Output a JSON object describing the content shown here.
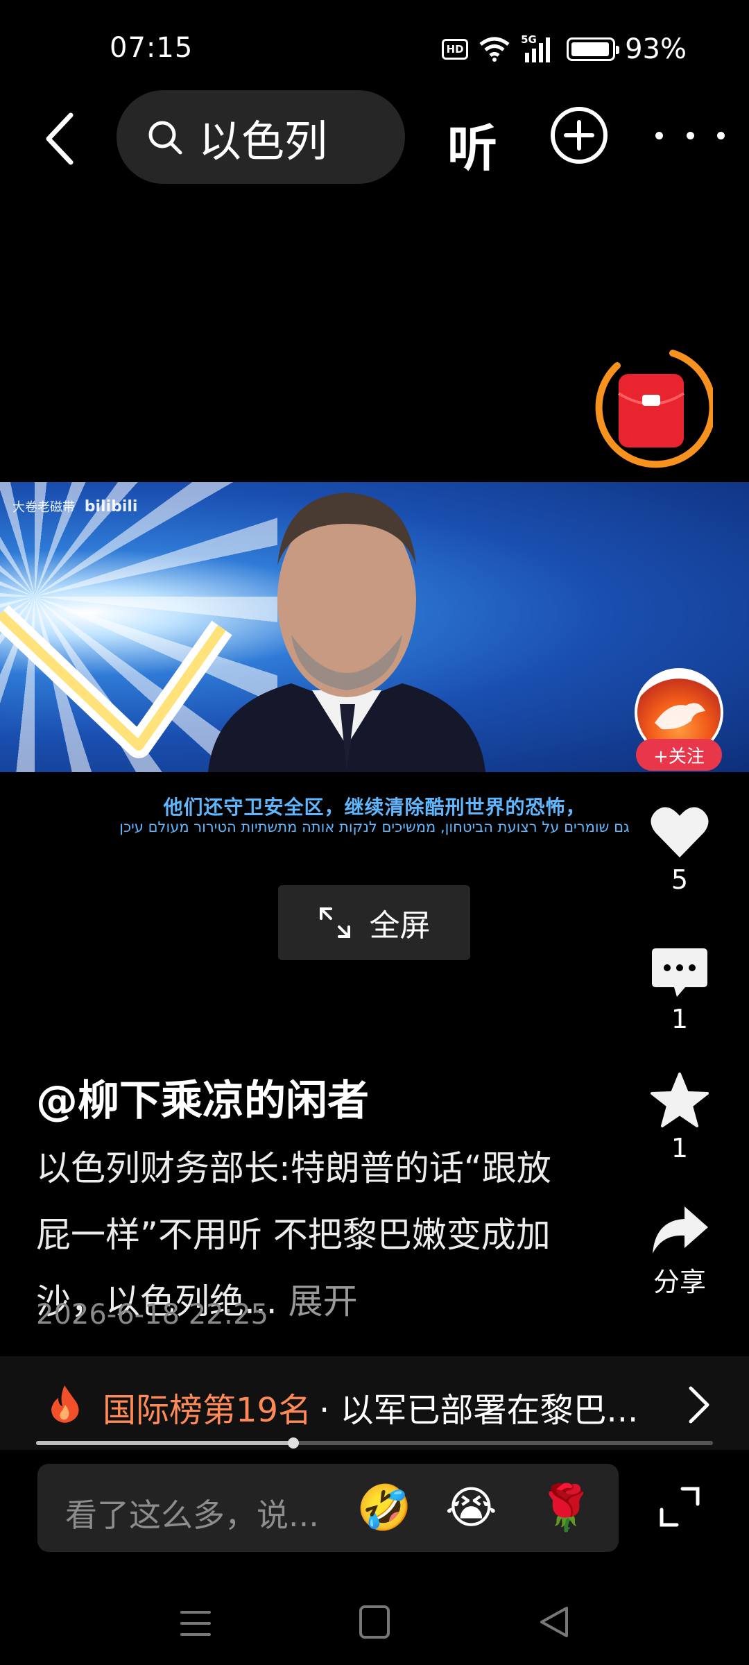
{
  "status_bar": {
    "time": "07:15",
    "hd": "HD",
    "network": "5G",
    "battery_percent": 93,
    "battery_text": "93%"
  },
  "top_nav": {
    "search_text": "以色列",
    "listen_label": "听"
  },
  "video": {
    "watermark_text": "大卷老磁带",
    "watermark_logo": "bilibili",
    "subtitle_cn": "他们还守卫安全区，继续清除酷刑世界的恐怖，",
    "subtitle_he": "גם שומרים על רצועת הביטחון, ממשיכים לנקות אותה מתשתיות הטירור מעולם עיכן",
    "fullscreen_label": "全屏"
  },
  "creator": {
    "follow_label": "+关注"
  },
  "actions": {
    "like_count": "5",
    "comment_count": "1",
    "favorite_count": "1",
    "share_label": "分享"
  },
  "post": {
    "author": "@柳下乘凉的闲者",
    "description": "以色列财务部长:特朗普的话“跟放屁一样”不用听 不把黎巴嫩变成加沙，以色列绝...",
    "expand_label": "展开",
    "time": "2026-6-18 22:25"
  },
  "ranking": {
    "label": "国际榜第19名",
    "text": "· 以军已部署在黎巴..."
  },
  "playback": {
    "progress": 0.38
  },
  "comment_bar": {
    "placeholder": "看了这么多，说...",
    "emojis": [
      "🤣",
      "😭",
      "🌹"
    ]
  },
  "colors": {
    "accent_orange": "#ff8a57",
    "follow_red": "#e8364a",
    "subtitle_blue": "#5fb8ff"
  }
}
